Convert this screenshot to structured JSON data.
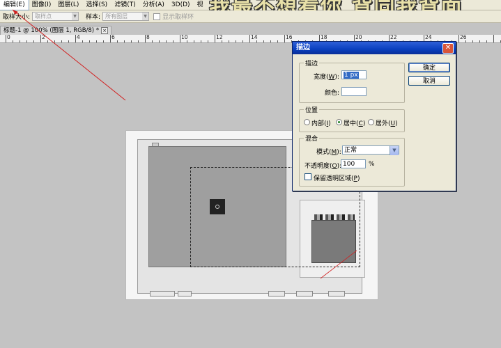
{
  "menubar": {
    "items": [
      {
        "label": "编辑(E)"
      },
      {
        "label": "图像(I)"
      },
      {
        "label": "图层(L)"
      },
      {
        "label": "选择(S)"
      },
      {
        "label": "滤镜(T)"
      },
      {
        "label": "分析(A)"
      },
      {
        "label": "3D(D)"
      },
      {
        "label": "视"
      }
    ]
  },
  "overlay_title": "我最不想看你 背同我背面",
  "options_bar": {
    "sample_size_label": "取样大小:",
    "sample_size_value": "取样点",
    "sample_label": "样本:",
    "sample_value": "所有图层",
    "show_ring_label": "显示取样环"
  },
  "document_tab": {
    "label": "标题-1 @ 100% (图层 1, RGB/8) *",
    "close": "×"
  },
  "ruler": {
    "labels": [
      "0",
      "2",
      "4",
      "6",
      "8",
      "10",
      "12",
      "14",
      "16",
      "18",
      "20",
      "22",
      "24",
      "26"
    ]
  },
  "stroke_dialog": {
    "title": "描边",
    "close_glyph": "✕",
    "stroke_group": {
      "title": "描边",
      "width_label": "宽度(W):",
      "width_value": "1 px",
      "color_label": "颜色:"
    },
    "location_group": {
      "title": "位置",
      "inside_label": "内部(I)",
      "center_label": "居中(C)",
      "outside_label": "居外(U)",
      "selected": "center"
    },
    "blend_group": {
      "title": "混合",
      "mode_label": "模式(M):",
      "mode_value": "正常",
      "opacity_label": "不透明度(O):",
      "opacity_value": "100",
      "opacity_unit": "%",
      "preserve_label": "保留透明区域(P)"
    },
    "ok_label": "确定",
    "cancel_label": "取消"
  },
  "colors": {
    "dialog_title_bar": "#0a3fbe",
    "close_button": "#d8553a",
    "annotation_line": "#d22020"
  }
}
